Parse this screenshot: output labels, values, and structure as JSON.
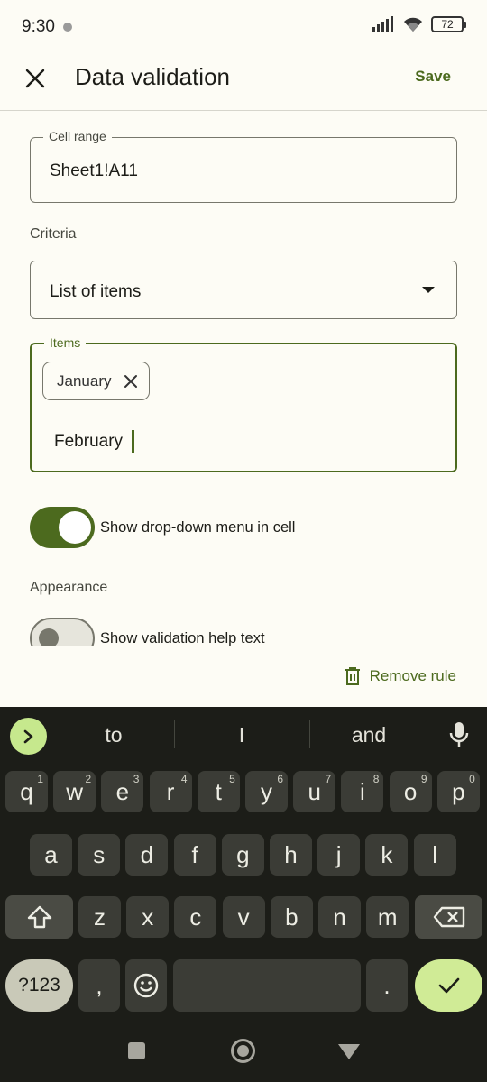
{
  "status_bar": {
    "time": "9:30",
    "battery": "72"
  },
  "app_bar": {
    "title": "Data validation",
    "save_label": "Save"
  },
  "cell_range": {
    "label": "Cell range",
    "value": "Sheet1!A11"
  },
  "criteria": {
    "label": "Criteria",
    "selected": "List of items"
  },
  "items": {
    "label": "Items",
    "chips": [
      "January"
    ],
    "input_value": "February"
  },
  "toggles": {
    "dropdown": {
      "label": "Show drop-down menu in cell",
      "on": true
    },
    "help_text": {
      "label": "Show validation help text",
      "on": false
    }
  },
  "appearance_label": "Appearance",
  "remove_rule_label": "Remove rule",
  "keyboard": {
    "suggestions": [
      "to",
      "I",
      "and"
    ],
    "row1": [
      {
        "k": "q",
        "h": "1"
      },
      {
        "k": "w",
        "h": "2"
      },
      {
        "k": "e",
        "h": "3"
      },
      {
        "k": "r",
        "h": "4"
      },
      {
        "k": "t",
        "h": "5"
      },
      {
        "k": "y",
        "h": "6"
      },
      {
        "k": "u",
        "h": "7"
      },
      {
        "k": "i",
        "h": "8"
      },
      {
        "k": "o",
        "h": "9"
      },
      {
        "k": "p",
        "h": "0"
      }
    ],
    "row2": [
      "a",
      "s",
      "d",
      "f",
      "g",
      "h",
      "j",
      "k",
      "l"
    ],
    "row3": [
      "z",
      "x",
      "c",
      "v",
      "b",
      "n",
      "m"
    ],
    "symbols_label": "?123",
    "comma": ",",
    "period": "."
  },
  "colors": {
    "accent": "#4c6a1e",
    "background": "#fdfcf5",
    "keyboard_bg": "#1c1d18",
    "key_bg": "#3b3c36",
    "enter_key": "#d0eb96"
  }
}
